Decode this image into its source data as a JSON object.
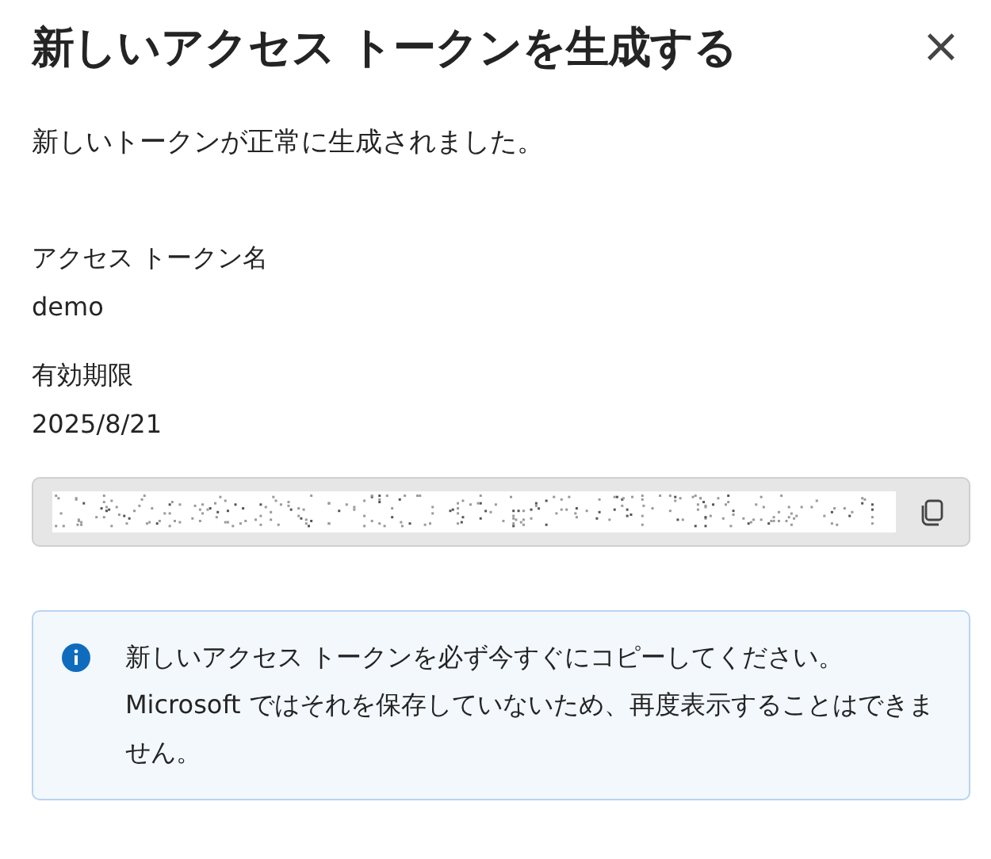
{
  "dialog": {
    "title": "新しいアクセス トークンを生成する",
    "close": "×"
  },
  "message": "新しいトークンが正常に生成されました。",
  "fields": [
    {
      "label": "アクセス トークン名",
      "value": "demo"
    },
    {
      "label": "有効期限",
      "value": "2025/8/21"
    }
  ],
  "token_field": {
    "redacted": true
  },
  "info": {
    "text": "新しいアクセス トークンを必ず今すぐにコピーしてください。Microsoft ではそれを保存していないため、再度表示することはできません。"
  }
}
